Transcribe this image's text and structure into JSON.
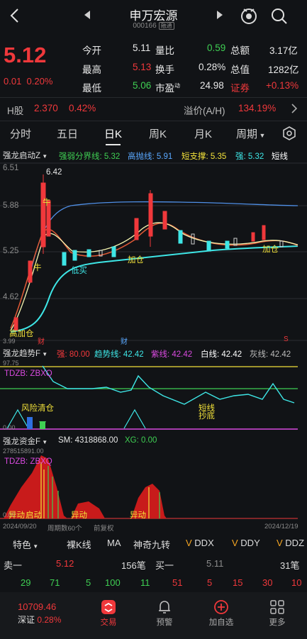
{
  "header": {
    "title": "申万宏源",
    "code": "000166",
    "tag": "融通"
  },
  "quote": {
    "price": "5.12",
    "change": "0.01",
    "change_pct": "0.20%",
    "open_label": "今开",
    "open": "5.11",
    "high_label": "最高",
    "high": "5.13",
    "low_label": "最低",
    "low": "5.06",
    "vol_ratio_label": "量比",
    "vol_ratio": "0.59",
    "turnover_label": "换手",
    "turnover": "0.28%",
    "pe_label": "市盈",
    "pe_sup": "动",
    "pe": "24.98",
    "amount_label": "总额",
    "amount": "3.17亿",
    "cap_label": "总值",
    "cap": "1282亿",
    "sector_label": "证券",
    "sector_pct": "+0.13%"
  },
  "hshare": {
    "label": "H股",
    "price": "2.370",
    "pct": "0.42%",
    "premium_label": "溢价(A/H)",
    "premium": "134.19%"
  },
  "tabs": [
    "分时",
    "五日",
    "日K",
    "周K",
    "月K",
    "周期"
  ],
  "panel1": {
    "name": "强龙启动Z",
    "l1": "强弱分界线: 5.32",
    "l2": "高抛线: 5.91",
    "l3": "短支撑: 5.35",
    "l4": "强: 5.32",
    "l5": "短线",
    "y1": "6.51",
    "y2": "5.88",
    "y3": "5.25",
    "y4": "4.62",
    "y5": "3.99",
    "peak": "6.42",
    "labels": {
      "niu1": "牛",
      "niu2": "牛",
      "dimai": "低买",
      "jiacang1": "加仓",
      "jiacang2": "加仓",
      "gaojiacang": "高加仓",
      "cai1": "财",
      "cai2": "财",
      "s": "S"
    }
  },
  "panel2": {
    "name": "强龙趋势F",
    "l1": "强: 80.00",
    "l2": "趋势线: 42.42",
    "l3": "紫线: 42.42",
    "l4": "白线: 42.42",
    "l5": "灰线: 42.42",
    "y1": "97.75",
    "y2": "0.00",
    "tdzb": "TDZB: ZBXQ",
    "risk": "风险清仓",
    "short": "短线抄底"
  },
  "panel3": {
    "name": "强龙资金F",
    "sm": "SM: 4318868.00",
    "xg": "XG: 0.00",
    "y1": "278515891.00",
    "y2": "0.00",
    "tdzb": "TDZB: ZBXQ",
    "a1": "异动",
    "a2": "异动",
    "a3": "异动",
    "a4": "启动"
  },
  "axis": {
    "start": "2024/09/20",
    "period": "周期数60个",
    "adj": "前复权",
    "end": "2024/12/19"
  },
  "tools": {
    "special": "特色",
    "items": [
      "裸K线",
      "MA",
      "神奇九转",
      "DDX",
      "DDY",
      "DDZ"
    ]
  },
  "orderbook": {
    "sell_label": "卖一",
    "sell_price": "5.12",
    "sell_count": "156笔",
    "buy_label": "买一",
    "buy_price": "5.11",
    "buy_count": "31笔",
    "sell_q": [
      "29",
      "71",
      "5",
      "100",
      "11"
    ],
    "buy_q": [
      "51",
      "5",
      "15",
      "30",
      "10"
    ]
  },
  "nav": {
    "index_value": "10709.46",
    "index_name": "深证",
    "index_pct": "0.28%",
    "items": [
      "交易",
      "预警",
      "加自选",
      "更多"
    ]
  },
  "colors": {
    "up": "#f0383b",
    "down": "#3fcf53",
    "cyan": "#3ee6e6",
    "yellow": "#f3e23a"
  }
}
